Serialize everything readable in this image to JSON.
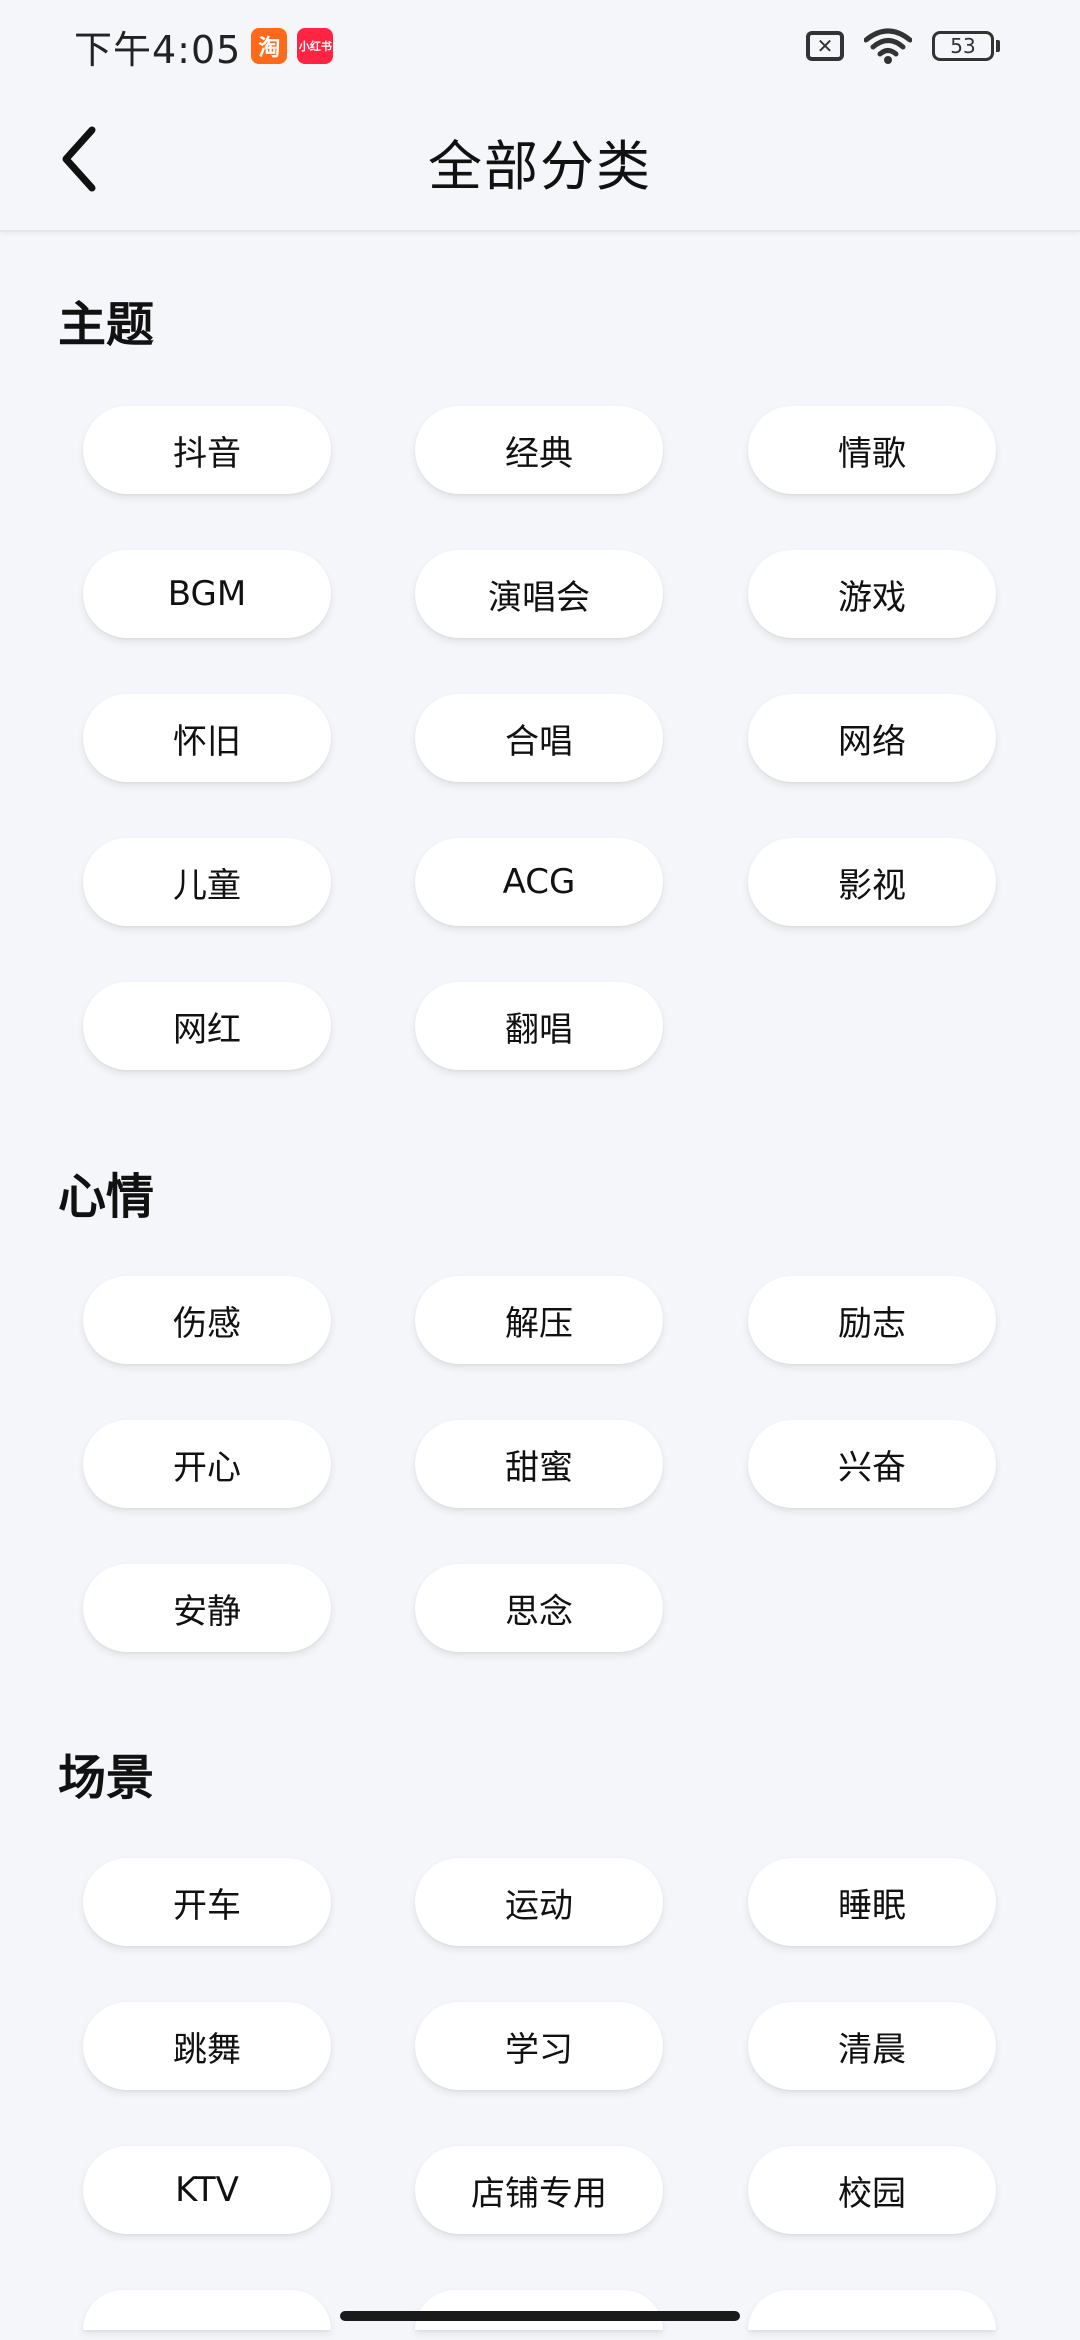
{
  "status_bar": {
    "time": "下午4:05",
    "apps": [
      {
        "name": "taobao",
        "label": "淘",
        "color": "#ff6a1a"
      },
      {
        "name": "xiaohongshu",
        "label": "小红书",
        "color": "#ff2442"
      }
    ],
    "battery": "53"
  },
  "header": {
    "title": "全部分类"
  },
  "sections": [
    {
      "title": "主题",
      "items": [
        "抖音",
        "经典",
        "情歌",
        "BGM",
        "演唱会",
        "游戏",
        "怀旧",
        "合唱",
        "网络",
        "儿童",
        "ACG",
        "影视",
        "网红",
        "翻唱"
      ]
    },
    {
      "title": "心情",
      "items": [
        "伤感",
        "解压",
        "励志",
        "开心",
        "甜蜜",
        "兴奋",
        "安静",
        "思念"
      ]
    },
    {
      "title": "场景",
      "items": [
        "开车",
        "运动",
        "睡眠",
        "跳舞",
        "学习",
        "清晨",
        "KTV",
        "店铺专用",
        "校园"
      ]
    }
  ]
}
